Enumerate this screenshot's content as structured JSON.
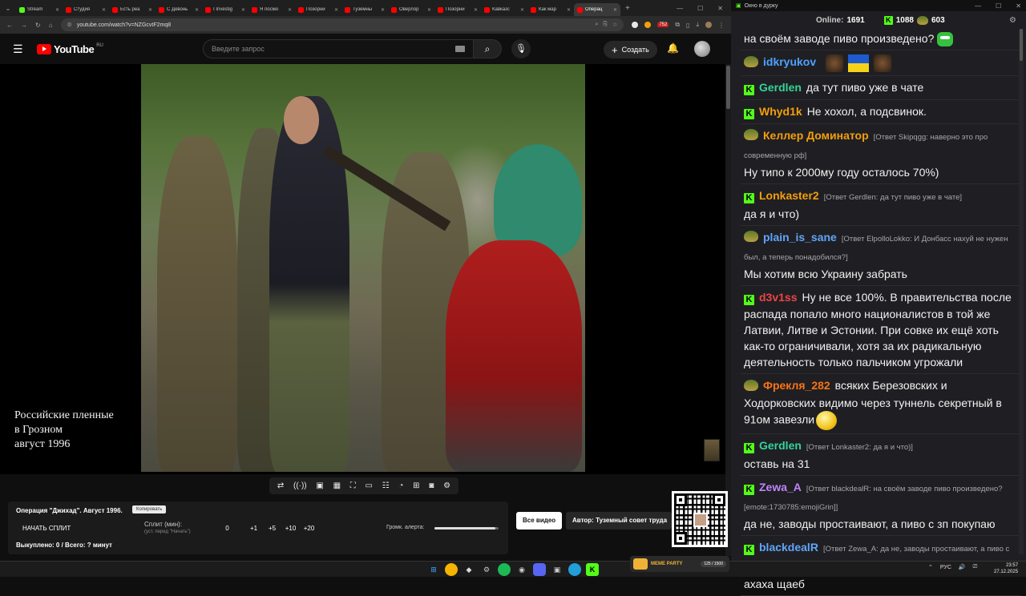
{
  "browser": {
    "tabs": [
      {
        "label": "Stream",
        "color": "#53fc18",
        "active": false
      },
      {
        "label": "Студия",
        "color": "#ff0000",
        "active": false
      },
      {
        "label": "Есть реа",
        "color": "#ff0000",
        "active": false
      },
      {
        "label": "С Девонь",
        "color": "#ff0000",
        "active": false
      },
      {
        "label": "I Investig",
        "color": "#ff0000",
        "active": false
      },
      {
        "label": "Я посмо",
        "color": "#ff0000",
        "active": false
      },
      {
        "label": "Позорни",
        "color": "#ff0000",
        "active": false
      },
      {
        "label": "Туземны",
        "color": "#ff0000",
        "active": false
      },
      {
        "label": "Оверлор",
        "color": "#ff0000",
        "active": false
      },
      {
        "label": "Позорни",
        "color": "#ff0000",
        "active": false
      },
      {
        "label": "Кавказс",
        "color": "#ff0000",
        "active": false
      },
      {
        "label": "Как мар",
        "color": "#ff0000",
        "active": false
      },
      {
        "label": "Операц",
        "color": "#ff0000",
        "active": true
      }
    ],
    "url": "youtube.com/watch?v=NZGcvtF2mq8",
    "ext_badge": "752"
  },
  "youtube": {
    "logo_text": "YouTube",
    "logo_region": "RU",
    "search_placeholder": "Введите запрос",
    "create_label": "Создать"
  },
  "video": {
    "caption": "Российские пленные\nв Грозном\nавгуст 1996"
  },
  "split": {
    "title": "Операция \"Джихад\". Август 1996.",
    "copy_label": "Копировать",
    "start_label": "НАЧАТЬ СПЛИТ",
    "split_label": "Сплит (мин):",
    "split_hint": "(уст. перед \"Начать\")",
    "values": [
      "0",
      "+1",
      "+5",
      "+10",
      "+20"
    ],
    "alert_volume_label": "Громк. алерта:",
    "alert_volume": 0.95,
    "done_label": "Выкуплено: 0 / Всего: ? минут",
    "all_videos_label": "Все видео",
    "author_label": "Автор: Туземный совет труда"
  },
  "chat": {
    "window_title": "Окно в дурку",
    "online_label": "Online:",
    "online_count": "1691",
    "kick_count": "1088",
    "other_count": "603",
    "messages": [
      {
        "badge": "",
        "user": "",
        "color": "#ffffff",
        "reply": "",
        "text": "на своём заводе пиво произведено?",
        "emote": "green"
      },
      {
        "badge": "pepe",
        "user": "idkryukov",
        "color": "#4da3ff",
        "reply": "",
        "text": "",
        "emote": "flags"
      },
      {
        "badge": "kick",
        "user": "Gerdlen",
        "color": "#34d399",
        "reply": "",
        "text": "да тут пиво уже в чате",
        "emote": ""
      },
      {
        "badge": "kick",
        "user": "Whyd1k",
        "color": "#f59e0b",
        "reply": "",
        "text": "Не хохол, а подсвинок.",
        "emote": ""
      },
      {
        "badge": "pepe",
        "user": "Келлер Доминатор",
        "color": "#f59e0b",
        "reply": "[Ответ Skipqgg: наверно это про современную рф]",
        "text": "Ну типо к 2000му году осталось 70%)",
        "emote": ""
      },
      {
        "badge": "kick",
        "user": "Lonkaster2",
        "color": "#f59e0b",
        "reply": "[Ответ Gerdlen: да тут пиво уже в чате]",
        "text": "да я и что)",
        "emote": ""
      },
      {
        "badge": "pepe",
        "user": "plain_is_sane",
        "color": "#60a5fa",
        "reply": "[Ответ ElpolloLokko: И Донбасс нахуй не нужен был, а теперь понадобился?]",
        "text": "Мы хотим всю Украину забрать",
        "emote": ""
      },
      {
        "badge": "kick",
        "user": "d3v1ss",
        "color": "#ef4444",
        "reply": "",
        "text": "Ну не все 100%. В правительства после распада попало много националистов в той же Латвии, Литве и Эстонии. При совке их ещё хоть как-то ограничивали, хотя за их радикальную деятельность только пальчиком угрожали",
        "emote": ""
      },
      {
        "badge": "pepe",
        "user": "Фрекля_282",
        "color": "#f97316",
        "reply": "",
        "text": "всяких Березовских и Ходорковских видимо через туннель секретный в 91ом завезли",
        "emote": "smile"
      },
      {
        "badge": "kick",
        "user": "Gerdlen",
        "color": "#34d399",
        "reply": "[Ответ Lonkaster2: да я и что)]",
        "text": "оставь на 31",
        "emote": ""
      },
      {
        "badge": "kick",
        "user": "Zewa_A",
        "color": "#c084fc",
        "reply": "[Ответ blackdealR: на своём заводе пиво произведено? [emote:1730785:emojiGrin]]",
        "text": "да не, заводы простаивают, а пиво с зп покупаю",
        "emote": ""
      },
      {
        "badge": "kick",
        "user": "blackdealR",
        "color": "#60a5fa",
        "reply": "[Ответ Zewa_A: да не, заводы простаивают, а пиво с зп покупаю]",
        "text": "ахаха щаеб",
        "emote": ""
      }
    ]
  },
  "meme_party": {
    "title": "MEME PARTY",
    "counter": "125 / 1500"
  },
  "taskbar": {
    "lang": "РУС",
    "time": "23:57",
    "date": "27.12.2025"
  }
}
